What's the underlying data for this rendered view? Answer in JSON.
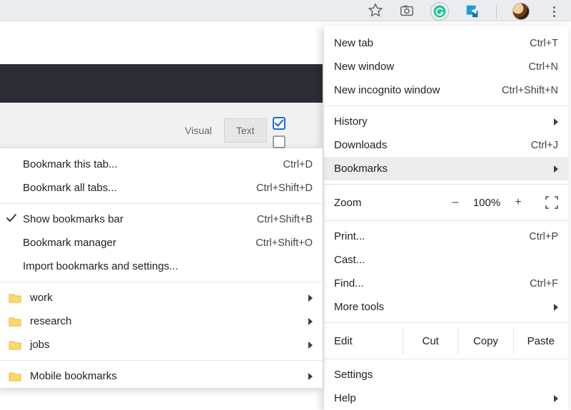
{
  "toolbar": {
    "star_title": "Bookmark this tab",
    "camera_title": "Screenshot",
    "g_title": "Grammarly",
    "share_title": "Share",
    "menu_title": "Customize and control"
  },
  "page_tabs": {
    "visual": "Visual",
    "text": "Text"
  },
  "main_menu": {
    "new_tab": {
      "label": "New tab",
      "shortcut": "Ctrl+T"
    },
    "new_window": {
      "label": "New window",
      "shortcut": "Ctrl+N"
    },
    "incognito": {
      "label": "New incognito window",
      "shortcut": "Ctrl+Shift+N"
    },
    "history": {
      "label": "History"
    },
    "downloads": {
      "label": "Downloads",
      "shortcut": "Ctrl+J"
    },
    "bookmarks": {
      "label": "Bookmarks"
    },
    "zoom": {
      "label": "Zoom",
      "value": "100%",
      "minus": "–",
      "plus": "+"
    },
    "print": {
      "label": "Print...",
      "shortcut": "Ctrl+P"
    },
    "cast": {
      "label": "Cast..."
    },
    "find": {
      "label": "Find...",
      "shortcut": "Ctrl+F"
    },
    "more_tools": {
      "label": "More tools"
    },
    "edit": {
      "label": "Edit",
      "cut": "Cut",
      "copy": "Copy",
      "paste": "Paste"
    },
    "settings": {
      "label": "Settings"
    },
    "help": {
      "label": "Help"
    }
  },
  "sub_menu": {
    "bookmark_tab": {
      "label": "Bookmark this tab...",
      "shortcut": "Ctrl+D"
    },
    "bookmark_all": {
      "label": "Bookmark all tabs...",
      "shortcut": "Ctrl+Shift+D"
    },
    "show_bar": {
      "label": "Show bookmarks bar",
      "shortcut": "Ctrl+Shift+B"
    },
    "manager": {
      "label": "Bookmark manager",
      "shortcut": "Ctrl+Shift+O"
    },
    "import": {
      "label": "Import bookmarks and settings..."
    },
    "folders": [
      {
        "label": "work"
      },
      {
        "label": "research"
      },
      {
        "label": "jobs"
      }
    ],
    "mobile": {
      "label": "Mobile bookmarks"
    }
  }
}
